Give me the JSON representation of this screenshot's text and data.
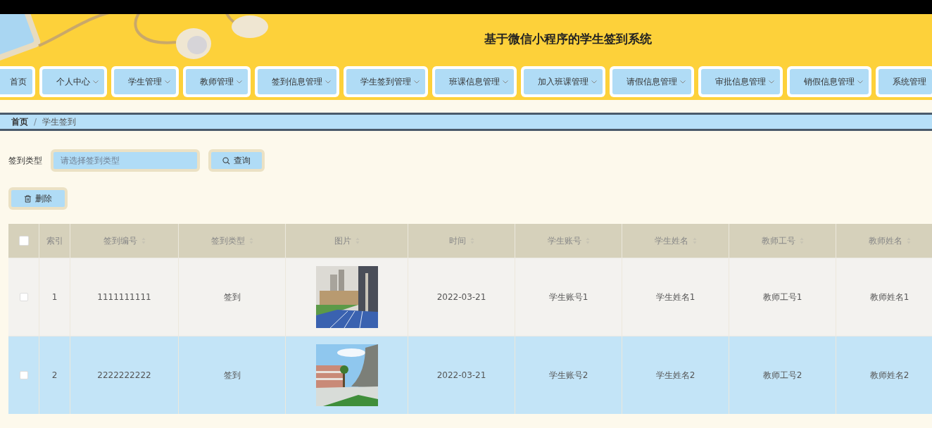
{
  "header": {
    "title": "基于微信小程序的学生签到系统",
    "banner": {
      "kind": "picture"
    }
  },
  "nav": [
    {
      "label": "首页",
      "dropdown": false
    },
    {
      "label": "个人中心",
      "dropdown": true
    },
    {
      "label": "学生管理",
      "dropdown": true
    },
    {
      "label": "教师管理",
      "dropdown": true
    },
    {
      "label": "签到信息管理",
      "dropdown": true
    },
    {
      "label": "学生签到管理",
      "dropdown": true
    },
    {
      "label": "班课信息管理",
      "dropdown": true
    },
    {
      "label": "加入班课管理",
      "dropdown": true
    },
    {
      "label": "请假信息管理",
      "dropdown": true
    },
    {
      "label": "审批信息管理",
      "dropdown": true
    },
    {
      "label": "销假信息管理",
      "dropdown": true
    },
    {
      "label": "系统管理",
      "dropdown": false
    }
  ],
  "breadcrumb": {
    "items": [
      "首页",
      "学生签到"
    ],
    "separator": "/"
  },
  "search": {
    "label": "签到类型",
    "placeholder": "请选择签到类型",
    "button": "查询"
  },
  "actions": {
    "delete": "删除"
  },
  "table": {
    "select_all": {
      "checked": false
    },
    "columns": [
      {
        "label": "索引",
        "sortable": false
      },
      {
        "label": "签到编号",
        "sortable": true
      },
      {
        "label": "签到类型",
        "sortable": true
      },
      {
        "label": "图片",
        "sortable": true
      },
      {
        "label": "时间",
        "sortable": true
      },
      {
        "label": "学生账号",
        "sortable": true
      },
      {
        "label": "学生姓名",
        "sortable": true
      },
      {
        "label": "教师工号",
        "sortable": true
      },
      {
        "label": "教师姓名",
        "sortable": true
      }
    ],
    "rows": [
      {
        "checked": false,
        "highlighted": false,
        "cells": [
          "1",
          "1111111111",
          "签到",
          {
            "kind": "picture"
          },
          "2022-03-21",
          "学生账号1",
          "学生姓名1",
          "教师工号1",
          "教师姓名1"
        ]
      },
      {
        "checked": false,
        "highlighted": true,
        "cells": [
          "2",
          "2222222222",
          "签到",
          {
            "kind": "picture"
          },
          "2022-03-21",
          "学生账号2",
          "学生姓名2",
          "教师工号2",
          "教师姓名2"
        ]
      }
    ]
  }
}
